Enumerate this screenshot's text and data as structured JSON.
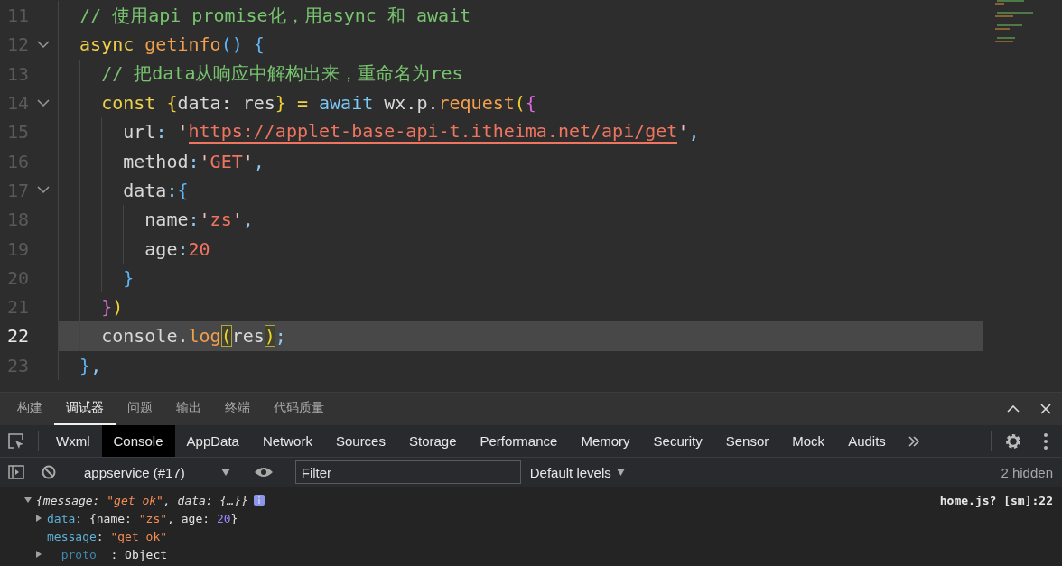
{
  "editor": {
    "lines": [
      {
        "number": "11",
        "fold": false,
        "current": false,
        "tokens": [
          {
            "text": "  // 使用api promise化，用async 和 await",
            "kind": "comment"
          }
        ]
      },
      {
        "number": "12",
        "fold": true,
        "current": false,
        "tokens": [
          {
            "text": "  async ",
            "kind": "keyword"
          },
          {
            "text": "getinfo",
            "kind": "function"
          },
          {
            "text": "() {",
            "kind": "brace3"
          }
        ]
      },
      {
        "number": "13",
        "fold": false,
        "current": false,
        "tokens": [
          {
            "text": "    // 把data从响应中解构出来，重命名为res",
            "kind": "comment"
          }
        ]
      },
      {
        "number": "14",
        "fold": true,
        "current": false,
        "tokens": [
          {
            "text": "    const ",
            "kind": "keyword"
          },
          {
            "text": "{",
            "kind": "brace1"
          },
          {
            "text": "data: res",
            "kind": "plain"
          },
          {
            "text": "}",
            "kind": "brace1"
          },
          {
            "text": " = ",
            "kind": "keyword"
          },
          {
            "text": "await",
            "kind": "control"
          },
          {
            "text": " wx.p.",
            "kind": "plain"
          },
          {
            "text": "request",
            "kind": "function"
          },
          {
            "text": "(",
            "kind": "brace1"
          },
          {
            "text": "{",
            "kind": "brace2"
          }
        ]
      },
      {
        "number": "15",
        "fold": false,
        "current": false,
        "tokens": [
          {
            "text": "      url",
            "kind": "plain"
          },
          {
            "text": ": ",
            "kind": "punct"
          },
          {
            "text": "'",
            "kind": "quote"
          },
          {
            "text": "https://applet-base-api-t.itheima.net/api/get",
            "kind": "url"
          },
          {
            "text": "'",
            "kind": "quote"
          },
          {
            "text": ",",
            "kind": "punct"
          }
        ]
      },
      {
        "number": "16",
        "fold": false,
        "current": false,
        "tokens": [
          {
            "text": "      method",
            "kind": "plain"
          },
          {
            "text": ":",
            "kind": "punct"
          },
          {
            "text": "'",
            "kind": "quote"
          },
          {
            "text": "GET",
            "kind": "string"
          },
          {
            "text": "'",
            "kind": "quote"
          },
          {
            "text": ",",
            "kind": "punct"
          }
        ]
      },
      {
        "number": "17",
        "fold": true,
        "current": false,
        "tokens": [
          {
            "text": "      data",
            "kind": "plain"
          },
          {
            "text": ":",
            "kind": "punct"
          },
          {
            "text": "{",
            "kind": "brace3"
          }
        ]
      },
      {
        "number": "18",
        "fold": false,
        "current": false,
        "tokens": [
          {
            "text": "        name",
            "kind": "plain"
          },
          {
            "text": ":",
            "kind": "punct"
          },
          {
            "text": "'",
            "kind": "quote"
          },
          {
            "text": "zs",
            "kind": "string"
          },
          {
            "text": "'",
            "kind": "quote"
          },
          {
            "text": ",",
            "kind": "punct"
          }
        ]
      },
      {
        "number": "19",
        "fold": false,
        "current": false,
        "tokens": [
          {
            "text": "        age",
            "kind": "plain"
          },
          {
            "text": ":",
            "kind": "punct"
          },
          {
            "text": "20",
            "kind": "number"
          }
        ]
      },
      {
        "number": "20",
        "fold": false,
        "current": false,
        "tokens": [
          {
            "text": "      }",
            "kind": "brace3"
          }
        ]
      },
      {
        "number": "21",
        "fold": false,
        "current": false,
        "tokens": [
          {
            "text": "    }",
            "kind": "brace2"
          },
          {
            "text": ")",
            "kind": "brace1"
          }
        ]
      },
      {
        "number": "22",
        "fold": false,
        "current": true,
        "tokens": [
          {
            "text": "    console.",
            "kind": "plain"
          },
          {
            "text": "log",
            "kind": "function"
          },
          {
            "text": "(",
            "kind": "match"
          },
          {
            "text": "res",
            "kind": "plain"
          },
          {
            "text": ")",
            "kind": "match"
          },
          {
            "text": ";",
            "kind": "punct"
          }
        ]
      },
      {
        "number": "23",
        "fold": false,
        "current": false,
        "tokens": [
          {
            "text": "  }",
            "kind": "brace3"
          },
          {
            "text": ",",
            "kind": "punct"
          }
        ]
      }
    ]
  },
  "panel_tabs": [
    {
      "label": "构建",
      "selected": false
    },
    {
      "label": "调试器",
      "selected": true
    },
    {
      "label": "问题",
      "selected": false
    },
    {
      "label": "输出",
      "selected": false
    },
    {
      "label": "终端",
      "selected": false
    },
    {
      "label": "代码质量",
      "selected": false
    }
  ],
  "devtools_tabs": [
    {
      "label": "Wxml",
      "selected": false
    },
    {
      "label": "Console",
      "selected": true
    },
    {
      "label": "AppData",
      "selected": false
    },
    {
      "label": "Network",
      "selected": false
    },
    {
      "label": "Sources",
      "selected": false
    },
    {
      "label": "Storage",
      "selected": false
    },
    {
      "label": "Performance",
      "selected": false
    },
    {
      "label": "Memory",
      "selected": false
    },
    {
      "label": "Security",
      "selected": false
    },
    {
      "label": "Sensor",
      "selected": false
    },
    {
      "label": "Mock",
      "selected": false
    },
    {
      "label": "Audits",
      "selected": false
    }
  ],
  "console_toolbar": {
    "context": "appservice (#17)",
    "filter": {
      "placeholder": "Filter"
    },
    "levels": "Default levels",
    "hidden": "2 hidden"
  },
  "console": {
    "entries": [
      {
        "expanded": true,
        "source": "home.js? [sm]:22",
        "summary": [
          {
            "text": "{message: ",
            "kind": "punct"
          },
          {
            "text": "\"get ok\"",
            "kind": "string"
          },
          {
            "text": ", data: {…}}",
            "kind": "punct"
          }
        ],
        "children": [
          {
            "expandable": true,
            "value": [
              {
                "text": "data",
                "kind": "key"
              },
              {
                "text": ": ",
                "kind": "punct"
              },
              {
                "text": "{name: ",
                "kind": "punct"
              },
              {
                "text": "\"zs\"",
                "kind": "string"
              },
              {
                "text": ", age: ",
                "kind": "punct"
              },
              {
                "text": "20",
                "kind": "number"
              },
              {
                "text": "}",
                "kind": "punct"
              }
            ]
          },
          {
            "expandable": false,
            "value": [
              {
                "text": "message",
                "kind": "key"
              },
              {
                "text": ": ",
                "kind": "punct"
              },
              {
                "text": "\"get ok\"",
                "kind": "string"
              }
            ]
          },
          {
            "expandable": true,
            "value": [
              {
                "text": "__proto__",
                "kind": "internal"
              },
              {
                "text": ": ",
                "kind": "punct"
              },
              {
                "text": "Object",
                "kind": "plain"
              }
            ]
          }
        ]
      }
    ]
  }
}
